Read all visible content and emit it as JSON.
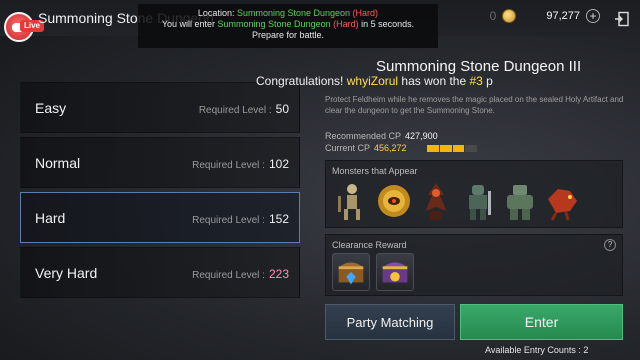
{
  "header": {
    "title": "Summoning Stone Dungeon",
    "live_badge": "Live",
    "currency": {
      "dim_value": "0",
      "gold": "97,277"
    }
  },
  "notice": {
    "line1_prefix": "Location: ",
    "line1_place": "Summoning Stone Dungeon",
    "line1_level": "(Hard)",
    "line2_prefix": "You will enter ",
    "line2_place": "Summoning Stone Dungeon",
    "line2_level": "(Hard)",
    "line2_suffix": " in 5 seconds.",
    "line3": "Prepare for battle."
  },
  "difficulties": [
    {
      "name": "Easy",
      "req_label": "Required Level :",
      "level": "50",
      "selected": false
    },
    {
      "name": "Normal",
      "req_label": "Required Level :",
      "level": "102",
      "selected": false
    },
    {
      "name": "Hard",
      "req_label": "Required Level :",
      "level": "152",
      "selected": true
    },
    {
      "name": "Very Hard",
      "req_label": "Required Level :",
      "level": "223",
      "selected": false
    }
  ],
  "dungeon": {
    "title": "Summoning Stone Dungeon III",
    "congrats_prefix": "Congratulations! ",
    "congrats_player": "whyiZorul",
    "congrats_mid": " has won the ",
    "congrats_rank": "#3",
    "congrats_suffix": " p",
    "description": "Protect Feldheim while he removes the magic placed on the sealed Holy Artifact and clear the dungeon to get the Summoning Stone."
  },
  "cp": {
    "recommended_label": "Recommended CP",
    "recommended_value": "427,900",
    "current_label": "Current CP",
    "current_value": "456,272",
    "bar_segments_filled": 3,
    "bar_segments_total": 4
  },
  "monsters": {
    "label": "Monsters that Appear",
    "items": [
      "skeleton-warrior-icon",
      "golden-orb-icon",
      "fire-demon-icon",
      "armored-knight-icon",
      "stone-golem-icon",
      "red-beast-icon"
    ]
  },
  "reward": {
    "label": "Clearance Reward",
    "help": "?",
    "items": [
      "treasure-chest-blue-icon",
      "treasure-chest-purple-icon"
    ]
  },
  "actions": {
    "party_label": "Party Matching",
    "enter_label": "Enter",
    "entry_count": "Available Entry Counts : 2"
  },
  "colors": {
    "accent_green": "#2f9a5d",
    "selected_border": "#5b7eb0",
    "highlight_yellow": "#ffe04a",
    "warning_red": "#ff5a5a",
    "location_green": "#5ad35a"
  }
}
